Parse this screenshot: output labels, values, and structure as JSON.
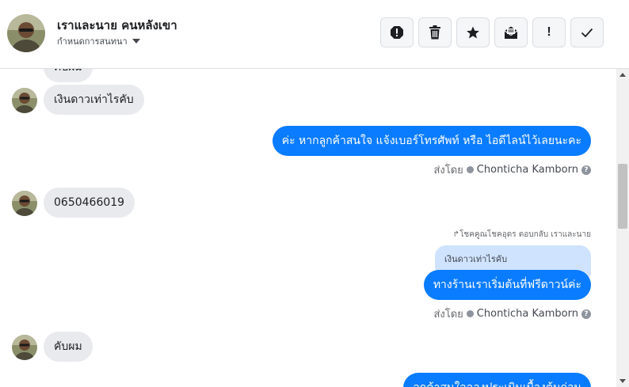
{
  "header": {
    "contact_name": "เราและนาย คนหลังเขา",
    "subtitle": "กำหนดการสนทนา",
    "actions": [
      {
        "name": "alert-icon",
        "label": ""
      },
      {
        "name": "trash-icon",
        "label": ""
      },
      {
        "name": "star-icon",
        "label": ""
      },
      {
        "name": "mail-icon",
        "label": ""
      },
      {
        "name": "exclamation-icon",
        "label": "!"
      },
      {
        "name": "check-icon",
        "label": ""
      }
    ]
  },
  "messages": {
    "m0_partial": "คับผม",
    "m1_in": "เงินดาวเท่าไรคับ",
    "m2_out": "ค่ะ หากลูกค้าสนใจ แจ้งเบอร์โทรศัพท์ หรือ ไอดีไลน์ไว้เลยนะคะ",
    "m3_in": "0650466019",
    "m4_reply_note": "โชคคูณโชคอุดร ตอบกลับ เราและนาย",
    "m4_quoted": "เงินดาวเท่าไรคับ",
    "m4_out": "ทางร้านเราเริ่มต้นที่ฟรีดาวน์ค่ะ",
    "m5_in": "คับผม",
    "m6_out_partial": "ลูกค้าสนใจลองประเมินเบื้องต้นก่อน"
  },
  "sent_by": {
    "prefix": "ส่งโดย",
    "name": "Chonticha Kamborn",
    "help": "?"
  },
  "colors": {
    "outgoing_bubble": "#0a7cff",
    "incoming_bubble": "#e9eaed",
    "quoted_bubble": "#cfe3ff"
  }
}
